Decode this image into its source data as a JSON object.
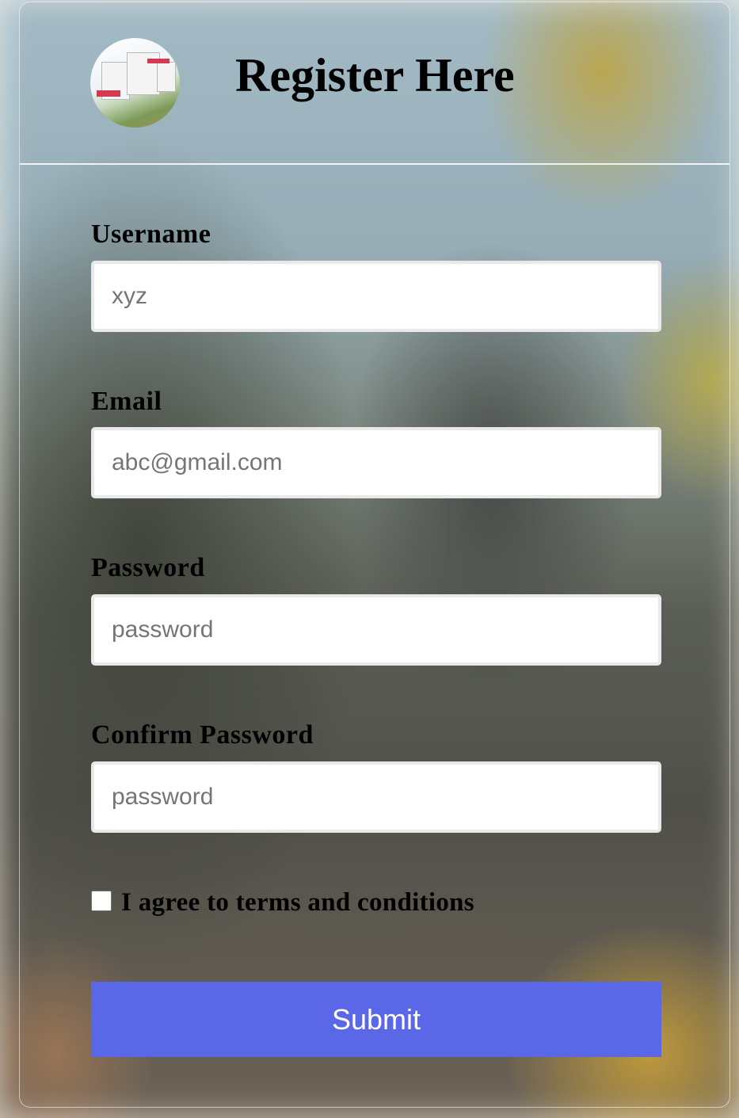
{
  "header": {
    "title": "Register Here"
  },
  "form": {
    "username": {
      "label": "Username",
      "placeholder": "xyz"
    },
    "email": {
      "label": "Email",
      "placeholder": "abc@gmail.com"
    },
    "password": {
      "label": "Password",
      "placeholder": "password"
    },
    "confirm_password": {
      "label": "Confirm Password",
      "placeholder": "password"
    },
    "terms": {
      "label": "I agree to terms and conditions",
      "checked": false
    },
    "submit_label": "Submit"
  },
  "colors": {
    "submit_button": "#5a68e8",
    "input_background": "#ffffff",
    "text": "#000000"
  }
}
